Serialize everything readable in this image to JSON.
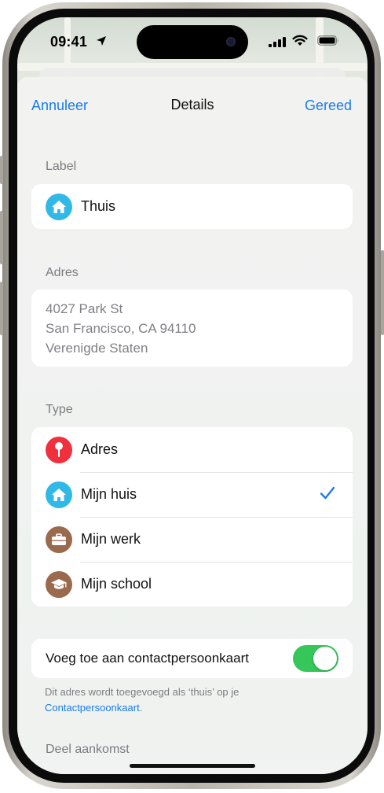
{
  "status_bar": {
    "time": "09:41"
  },
  "nav": {
    "cancel": "Annuleer",
    "title": "Details",
    "done": "Gereed"
  },
  "label_section": {
    "header": "Label",
    "value": "Thuis",
    "icon": "house-icon"
  },
  "address_section": {
    "header": "Adres",
    "lines": [
      "4027 Park St",
      "San Francisco, CA  94110",
      "Verenigde Staten"
    ]
  },
  "type_section": {
    "header": "Type",
    "items": [
      {
        "label": "Adres",
        "icon": "pin-icon",
        "color": "#f0303c",
        "selected": false
      },
      {
        "label": "Mijn huis",
        "icon": "house-icon",
        "color": "#30b9e6",
        "selected": true
      },
      {
        "label": "Mijn werk",
        "icon": "briefcase-icon",
        "color": "#9a6a4c",
        "selected": false
      },
      {
        "label": "Mijn school",
        "icon": "graduation-cap-icon",
        "color": "#9a6a4c",
        "selected": false
      }
    ]
  },
  "contact_toggle": {
    "label": "Voeg toe aan contactpersoonkaart",
    "on": true,
    "footnote_text": "Dit adres wordt toegevoegd als ‘thuis’ op je",
    "footnote_link": "Contactpersoonkaart",
    "footnote_end": "."
  },
  "share_section": {
    "header": "Deel aankomst"
  },
  "colors": {
    "accent": "#1a7bec",
    "toggle_on": "#35c759",
    "house": "#30b9e6",
    "pin": "#f0303c",
    "brown": "#9a6a4c"
  }
}
